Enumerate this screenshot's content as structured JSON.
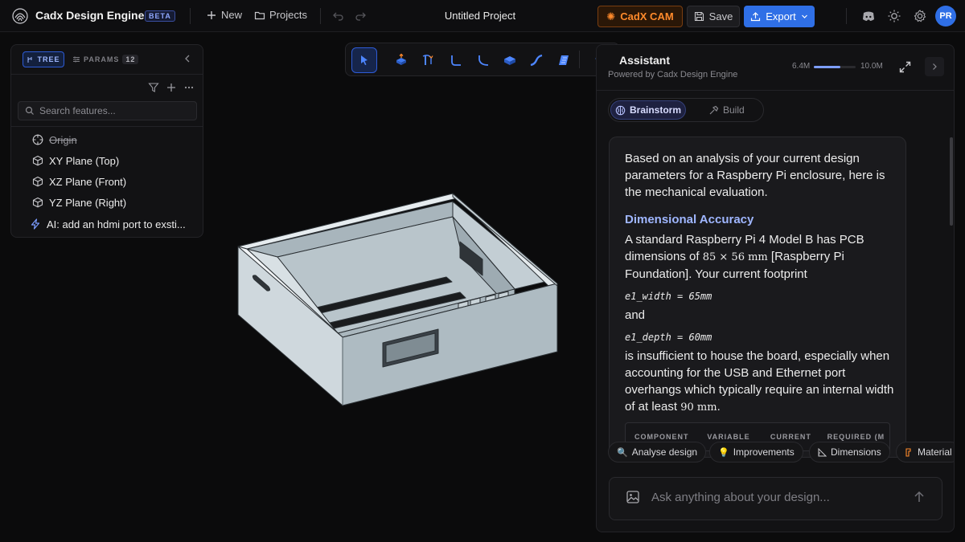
{
  "header": {
    "app_title": "Cadx Design Engine",
    "beta_label": "BETA",
    "new_label": "New",
    "projects_label": "Projects",
    "project_title": "Untitled Project",
    "cam_label": "CadX CAM",
    "save_label": "Save",
    "export_label": "Export",
    "avatar_initials": "PR"
  },
  "tree_panel": {
    "tab_tree": "TREE",
    "tab_params": "PARAMS",
    "params_count": "12",
    "search_placeholder": "Search features...",
    "items": [
      {
        "label": "Origin",
        "icon": "target-icon",
        "struck": true
      },
      {
        "label": "XY Plane (Top)",
        "icon": "cube-icon"
      },
      {
        "label": "XZ Plane (Front)",
        "icon": "cube-icon"
      },
      {
        "label": "YZ Plane (Right)",
        "icon": "cube-icon"
      },
      {
        "label": "AI: add an hdmi port to exsti...",
        "icon": "lightning-icon"
      }
    ]
  },
  "viewport_toolbar": {
    "tools": [
      "select-cursor-icon",
      "extrude-icon",
      "revolve-icon",
      "fillet-icon",
      "chamfer-icon",
      "box-icon",
      "sweep-icon",
      "loft-icon",
      "graduation-cap-icon"
    ],
    "active": "select-cursor-icon"
  },
  "assistant": {
    "title": "Assistant",
    "subtitle": "Powered by Cadx Design Engine",
    "token_used": "6.4M",
    "token_max": "10.0M",
    "token_fraction": 0.64,
    "mode_brainstorm": "Brainstorm",
    "mode_build": "Build",
    "message": {
      "intro": "Based on an analysis of your current design parameters for a Raspberry Pi enclosure, here is the mechanical evaluation.",
      "heading": "Dimensional Accuracy",
      "para1_a": "A standard Raspberry Pi 4 Model B has PCB dimensions of ",
      "para1_math": "85 × 56 mm",
      "para1_b": " [Raspberry Pi Foundation]. Your current footprint",
      "code1": "e1_width = 65mm",
      "and_text": "and",
      "code2": "e1_depth = 60mm",
      "para2_a": "is insufficient to house the board, especially when accounting for the USB and Ethernet port overhangs which typically require an internal width of at least ",
      "para2_math": "90 mm",
      "para2_b": ".",
      "table_headers": [
        "COMPONENT",
        "VARIABLE",
        "CURRENT",
        "REQUIRED (M"
      ]
    },
    "chips": [
      {
        "label": "Analyse design",
        "icon": "magnifier-icon"
      },
      {
        "label": "Improvements",
        "icon": "lightbulb-icon"
      },
      {
        "label": "Dimensions",
        "icon": "ruler-icon"
      },
      {
        "label": "Material",
        "icon": "material-icon"
      }
    ],
    "composer_placeholder": "Ask anything about your design..."
  },
  "colors": {
    "accent_blue": "#2f6fe6",
    "cam_orange": "#ff8a2b",
    "heading_blue": "#9fb6ff",
    "model_fill": "#b4c1c8"
  }
}
